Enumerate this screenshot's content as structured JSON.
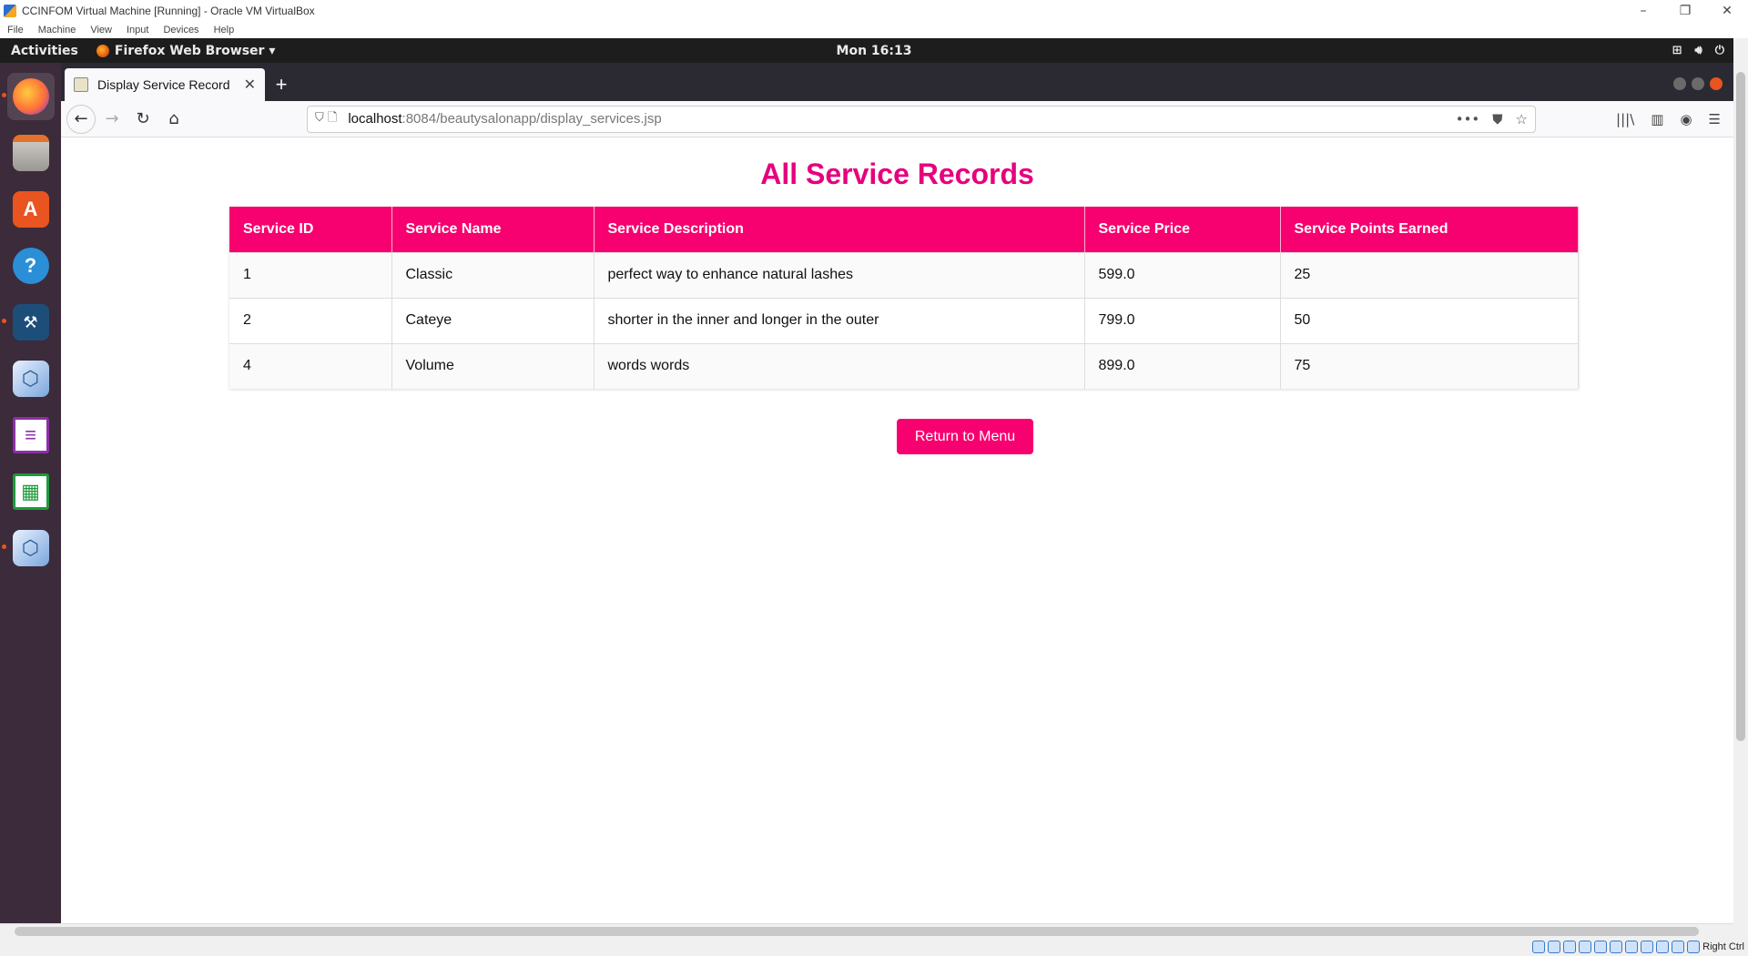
{
  "host_window": {
    "title": "CCINFOM Virtual Machine [Running] - Oracle VM VirtualBox",
    "menu": [
      "File",
      "Machine",
      "View",
      "Input",
      "Devices",
      "Help"
    ],
    "status_text": "Right Ctrl"
  },
  "topbar": {
    "activities": "Activities",
    "app_name": "Firefox Web Browser",
    "clock": "Mon 16:13"
  },
  "browser": {
    "tab_title": "Display Service Record",
    "url_host": "localhost",
    "url_path": ":8084/beautysalonapp/display_services.jsp"
  },
  "page": {
    "title": "All Service Records",
    "table": {
      "headers": [
        "Service ID",
        "Service Name",
        "Service Description",
        "Service Price",
        "Service Points Earned"
      ],
      "rows": [
        [
          "1",
          "Classic",
          "perfect way to enhance natural lashes",
          "599.0",
          "25"
        ],
        [
          "2",
          "Cateye",
          "shorter in the inner and longer in the outer",
          "799.0",
          "50"
        ],
        [
          "4",
          "Volume",
          "words words",
          "899.0",
          "75"
        ]
      ]
    },
    "return_button": "Return to Menu"
  },
  "colors": {
    "accent": "#f7006f",
    "title": "#e6007e"
  }
}
